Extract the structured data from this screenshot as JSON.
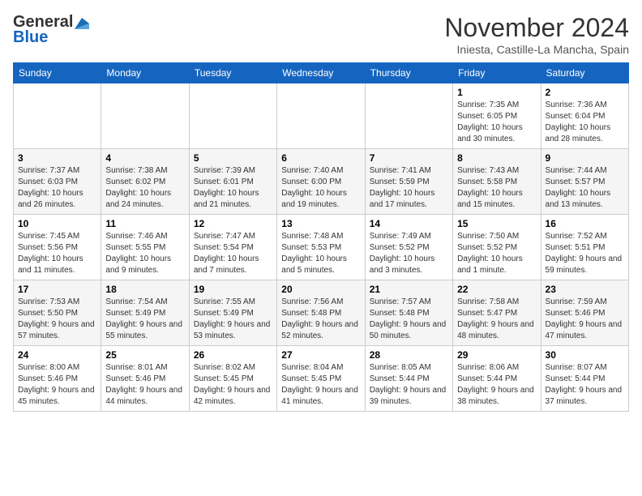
{
  "header": {
    "logo_line1": "General",
    "logo_line2": "Blue",
    "month_title": "November 2024",
    "location": "Iniesta, Castille-La Mancha, Spain"
  },
  "weekdays": [
    "Sunday",
    "Monday",
    "Tuesday",
    "Wednesday",
    "Thursday",
    "Friday",
    "Saturday"
  ],
  "weeks": [
    [
      {
        "day": "",
        "sunrise": "",
        "sunset": "",
        "daylight": ""
      },
      {
        "day": "",
        "sunrise": "",
        "sunset": "",
        "daylight": ""
      },
      {
        "day": "",
        "sunrise": "",
        "sunset": "",
        "daylight": ""
      },
      {
        "day": "",
        "sunrise": "",
        "sunset": "",
        "daylight": ""
      },
      {
        "day": "",
        "sunrise": "",
        "sunset": "",
        "daylight": ""
      },
      {
        "day": "1",
        "sunrise": "Sunrise: 7:35 AM",
        "sunset": "Sunset: 6:05 PM",
        "daylight": "Daylight: 10 hours and 30 minutes."
      },
      {
        "day": "2",
        "sunrise": "Sunrise: 7:36 AM",
        "sunset": "Sunset: 6:04 PM",
        "daylight": "Daylight: 10 hours and 28 minutes."
      }
    ],
    [
      {
        "day": "3",
        "sunrise": "Sunrise: 7:37 AM",
        "sunset": "Sunset: 6:03 PM",
        "daylight": "Daylight: 10 hours and 26 minutes."
      },
      {
        "day": "4",
        "sunrise": "Sunrise: 7:38 AM",
        "sunset": "Sunset: 6:02 PM",
        "daylight": "Daylight: 10 hours and 24 minutes."
      },
      {
        "day": "5",
        "sunrise": "Sunrise: 7:39 AM",
        "sunset": "Sunset: 6:01 PM",
        "daylight": "Daylight: 10 hours and 21 minutes."
      },
      {
        "day": "6",
        "sunrise": "Sunrise: 7:40 AM",
        "sunset": "Sunset: 6:00 PM",
        "daylight": "Daylight: 10 hours and 19 minutes."
      },
      {
        "day": "7",
        "sunrise": "Sunrise: 7:41 AM",
        "sunset": "Sunset: 5:59 PM",
        "daylight": "Daylight: 10 hours and 17 minutes."
      },
      {
        "day": "8",
        "sunrise": "Sunrise: 7:43 AM",
        "sunset": "Sunset: 5:58 PM",
        "daylight": "Daylight: 10 hours and 15 minutes."
      },
      {
        "day": "9",
        "sunrise": "Sunrise: 7:44 AM",
        "sunset": "Sunset: 5:57 PM",
        "daylight": "Daylight: 10 hours and 13 minutes."
      }
    ],
    [
      {
        "day": "10",
        "sunrise": "Sunrise: 7:45 AM",
        "sunset": "Sunset: 5:56 PM",
        "daylight": "Daylight: 10 hours and 11 minutes."
      },
      {
        "day": "11",
        "sunrise": "Sunrise: 7:46 AM",
        "sunset": "Sunset: 5:55 PM",
        "daylight": "Daylight: 10 hours and 9 minutes."
      },
      {
        "day": "12",
        "sunrise": "Sunrise: 7:47 AM",
        "sunset": "Sunset: 5:54 PM",
        "daylight": "Daylight: 10 hours and 7 minutes."
      },
      {
        "day": "13",
        "sunrise": "Sunrise: 7:48 AM",
        "sunset": "Sunset: 5:53 PM",
        "daylight": "Daylight: 10 hours and 5 minutes."
      },
      {
        "day": "14",
        "sunrise": "Sunrise: 7:49 AM",
        "sunset": "Sunset: 5:52 PM",
        "daylight": "Daylight: 10 hours and 3 minutes."
      },
      {
        "day": "15",
        "sunrise": "Sunrise: 7:50 AM",
        "sunset": "Sunset: 5:52 PM",
        "daylight": "Daylight: 10 hours and 1 minute."
      },
      {
        "day": "16",
        "sunrise": "Sunrise: 7:52 AM",
        "sunset": "Sunset: 5:51 PM",
        "daylight": "Daylight: 9 hours and 59 minutes."
      }
    ],
    [
      {
        "day": "17",
        "sunrise": "Sunrise: 7:53 AM",
        "sunset": "Sunset: 5:50 PM",
        "daylight": "Daylight: 9 hours and 57 minutes."
      },
      {
        "day": "18",
        "sunrise": "Sunrise: 7:54 AM",
        "sunset": "Sunset: 5:49 PM",
        "daylight": "Daylight: 9 hours and 55 minutes."
      },
      {
        "day": "19",
        "sunrise": "Sunrise: 7:55 AM",
        "sunset": "Sunset: 5:49 PM",
        "daylight": "Daylight: 9 hours and 53 minutes."
      },
      {
        "day": "20",
        "sunrise": "Sunrise: 7:56 AM",
        "sunset": "Sunset: 5:48 PM",
        "daylight": "Daylight: 9 hours and 52 minutes."
      },
      {
        "day": "21",
        "sunrise": "Sunrise: 7:57 AM",
        "sunset": "Sunset: 5:48 PM",
        "daylight": "Daylight: 9 hours and 50 minutes."
      },
      {
        "day": "22",
        "sunrise": "Sunrise: 7:58 AM",
        "sunset": "Sunset: 5:47 PM",
        "daylight": "Daylight: 9 hours and 48 minutes."
      },
      {
        "day": "23",
        "sunrise": "Sunrise: 7:59 AM",
        "sunset": "Sunset: 5:46 PM",
        "daylight": "Daylight: 9 hours and 47 minutes."
      }
    ],
    [
      {
        "day": "24",
        "sunrise": "Sunrise: 8:00 AM",
        "sunset": "Sunset: 5:46 PM",
        "daylight": "Daylight: 9 hours and 45 minutes."
      },
      {
        "day": "25",
        "sunrise": "Sunrise: 8:01 AM",
        "sunset": "Sunset: 5:46 PM",
        "daylight": "Daylight: 9 hours and 44 minutes."
      },
      {
        "day": "26",
        "sunrise": "Sunrise: 8:02 AM",
        "sunset": "Sunset: 5:45 PM",
        "daylight": "Daylight: 9 hours and 42 minutes."
      },
      {
        "day": "27",
        "sunrise": "Sunrise: 8:04 AM",
        "sunset": "Sunset: 5:45 PM",
        "daylight": "Daylight: 9 hours and 41 minutes."
      },
      {
        "day": "28",
        "sunrise": "Sunrise: 8:05 AM",
        "sunset": "Sunset: 5:44 PM",
        "daylight": "Daylight: 9 hours and 39 minutes."
      },
      {
        "day": "29",
        "sunrise": "Sunrise: 8:06 AM",
        "sunset": "Sunset: 5:44 PM",
        "daylight": "Daylight: 9 hours and 38 minutes."
      },
      {
        "day": "30",
        "sunrise": "Sunrise: 8:07 AM",
        "sunset": "Sunset: 5:44 PM",
        "daylight": "Daylight: 9 hours and 37 minutes."
      }
    ]
  ]
}
